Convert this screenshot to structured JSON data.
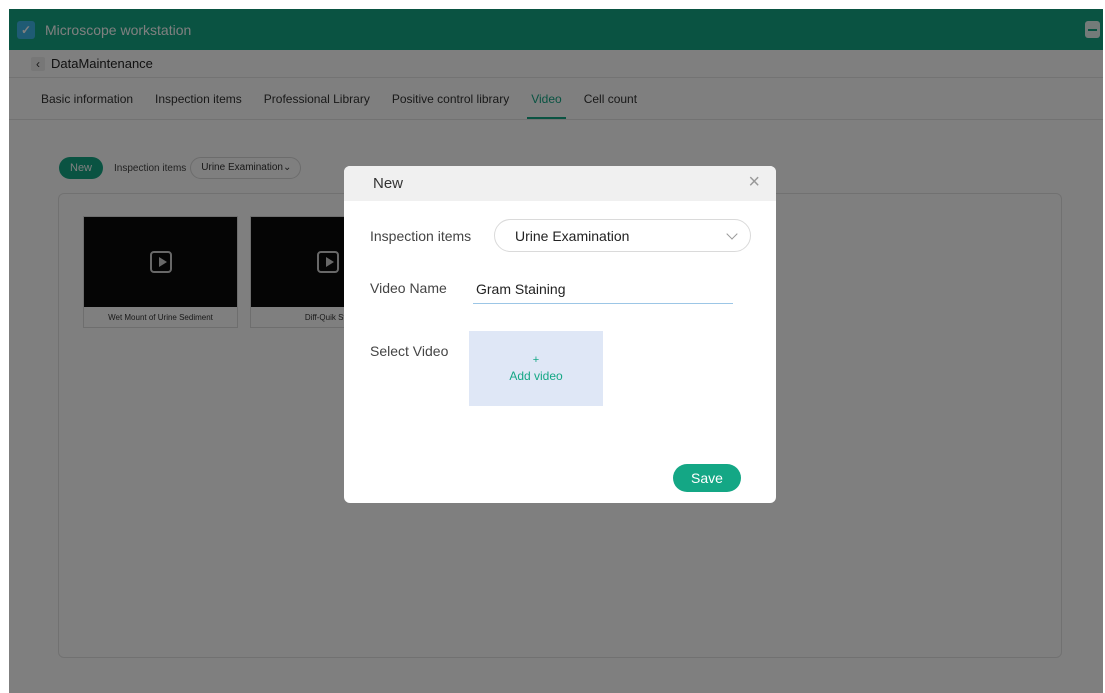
{
  "app": {
    "title": "Microscope workstation",
    "logo_icon": "microscope-logo-icon"
  },
  "breadcrumb": {
    "back_icon": "chevron-left-icon",
    "title": "DataMaintenance"
  },
  "tabs": [
    {
      "label": "Basic information",
      "active": false
    },
    {
      "label": "Inspection items",
      "active": false
    },
    {
      "label": "Professional Library",
      "active": false
    },
    {
      "label": "Positive control library",
      "active": false
    },
    {
      "label": "Video",
      "active": true
    },
    {
      "label": "Cell count",
      "active": false
    }
  ],
  "toolbar": {
    "new_label": "New",
    "filter_label": "Inspection items",
    "filter_value": "Urine Examination"
  },
  "videos": [
    {
      "caption": "Wet Mount of Urine Sediment"
    },
    {
      "caption": "Diff-Quik Sta"
    }
  ],
  "modal": {
    "title": "New",
    "close_icon": "close-icon",
    "inspection_label": "Inspection items",
    "inspection_value": "Urine Examination",
    "video_name_label": "Video Name",
    "video_name_value": "Gram Staining",
    "select_video_label": "Select Video",
    "add_video_plus": "+",
    "add_video_label": "Add video",
    "save_label": "Save"
  },
  "colors": {
    "accent": "#14a785",
    "upload_bg": "#dfe7f6"
  }
}
